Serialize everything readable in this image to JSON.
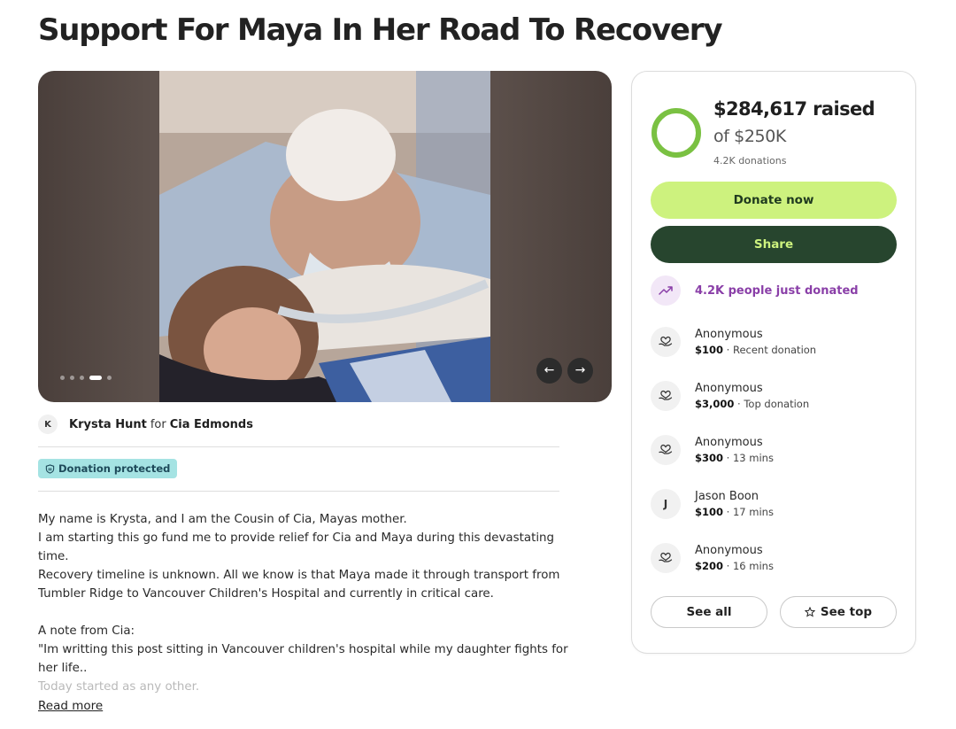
{
  "page": {
    "title": "Support For Maya In Her Road To Recovery"
  },
  "gallery": {
    "prev_glyph": "←",
    "next_glyph": "→",
    "slide_count": 5,
    "active_slide": 4
  },
  "organizer": {
    "avatar_initial": "K",
    "name": "Krysta Hunt",
    "connector": "for",
    "beneficiary": "Cia Edmonds"
  },
  "badge": {
    "label": "Donation protected",
    "icon": "shield-icon"
  },
  "story": {
    "lines": [
      "My name is Krysta, and I am the Cousin of Cia, Mayas mother.",
      "I am starting this go fund me to provide relief for Cia and Maya during this devastating time.",
      "Recovery timeline is unknown. All we know is that Maya made it through transport from Tumbler Ridge to Vancouver Children's Hospital and currently in critical care."
    ],
    "note_heading": "A note from Cia:",
    "quote": "\"Im writting this post sitting in Vancouver children's hospital while my daughter fights for her life..",
    "faded_line": "Today started as any other.",
    "read_more": "Read more"
  },
  "progress": {
    "raised": "$284,617 raised",
    "goal": "of $250K",
    "donation_count": "4.2K donations",
    "fraction": 1.0,
    "ring_color": "#7ac142"
  },
  "actions": {
    "donate_label": "Donate now",
    "share_label": "Share"
  },
  "trending": {
    "text": "4.2K people just donated",
    "icon": "trending-up-icon"
  },
  "donations": [
    {
      "name": "Anonymous",
      "amount": "$100",
      "detail": " · Recent donation",
      "avatar": "heart-hand-icon"
    },
    {
      "name": "Anonymous",
      "amount": "$3,000",
      "detail": " · Top donation",
      "avatar": "heart-hand-icon"
    },
    {
      "name": "Anonymous",
      "amount": "$300",
      "detail": " · 13 mins",
      "avatar": "heart-hand-icon"
    },
    {
      "name": "Jason Boon",
      "amount": "$100",
      "detail": " · 17 mins",
      "avatar": "J"
    },
    {
      "name": "Anonymous",
      "amount": "$200",
      "detail": " · 16 mins",
      "avatar": "heart-hand-icon"
    }
  ],
  "footer_buttons": {
    "see_all": "See all",
    "see_top": "See top",
    "see_top_icon": "star-icon"
  },
  "colors": {
    "accent_green": "#cdf27e",
    "dark_green": "#27452e",
    "purple": "#8a3fa8",
    "badge_bg": "#a5e3e3"
  }
}
